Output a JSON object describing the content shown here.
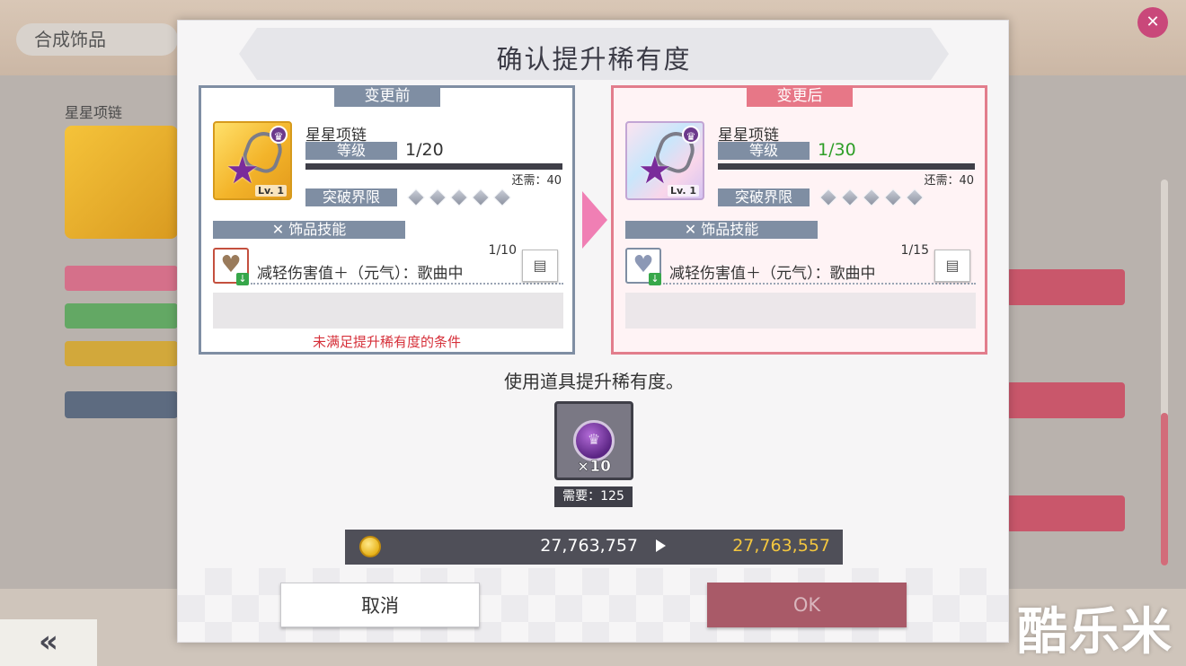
{
  "background": {
    "screen_title": "合成饰品",
    "left_item_name": "星星项链",
    "top_right_text": "",
    "back_label": "«",
    "watermark": "酷乐米"
  },
  "dialog": {
    "title": "确认提升稀有度",
    "before": {
      "tag": "变更前",
      "item_name": "星星项链",
      "level_label": "等级",
      "level_value": "1/20",
      "remaining": "还需：40",
      "limit_label": "突破界限",
      "skill_header": "✕ 饰品技能",
      "skill_level": "1/10",
      "skill_text": "减轻伤害值＋（元气）：歌曲中",
      "card_lv": "Lv. 1",
      "warning": "未满足提升稀有度的条件"
    },
    "after": {
      "tag": "变更后",
      "item_name": "星星项链",
      "level_label": "等级",
      "level_value": "1/30",
      "remaining": "还需：40",
      "limit_label": "突破界限",
      "skill_header": "✕ 饰品技能",
      "skill_level": "1/15",
      "skill_text": "减轻伤害值＋（元气）：歌曲中",
      "card_lv": "Lv. 1"
    },
    "use_text": "使用道具提升稀有度。",
    "material": {
      "quantity": "×10",
      "need": "需要：125"
    },
    "money": {
      "from": "27,763,757",
      "to": "27,763,557"
    },
    "buttons": {
      "cancel": "取消",
      "ok": "OK"
    }
  },
  "colors": {
    "accent_before": "#7f8ea3",
    "accent_after": "#e77787",
    "level_after": "#2e9e27",
    "warning": "#d6303a",
    "money_to": "#f3c63f"
  }
}
